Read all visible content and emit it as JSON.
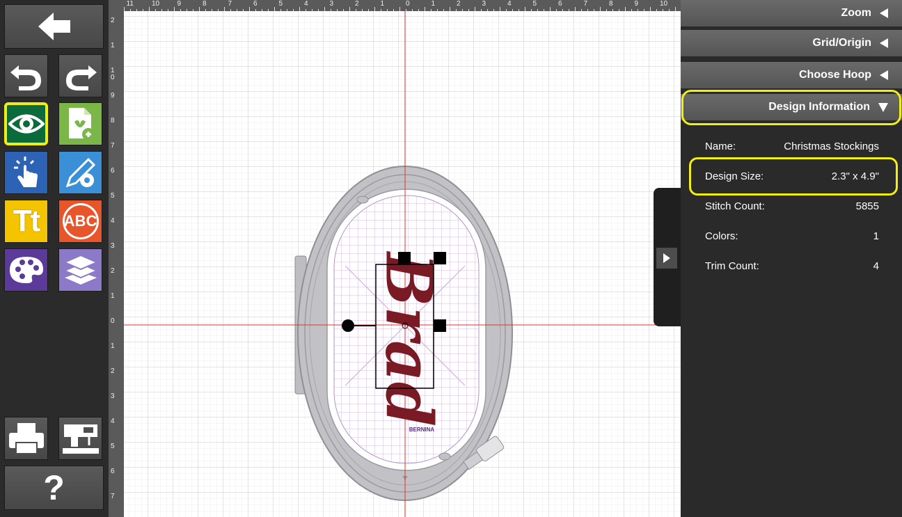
{
  "toolbar": {
    "back": "back-arrow-icon",
    "undo": "undo-icon",
    "redo": "redo-icon",
    "view": "eye-icon",
    "add_design": "new-design-icon",
    "select": "touch-select-icon",
    "edit": "edit-gear-icon",
    "text": "Tt",
    "monogram": "ABC",
    "colors": "palette-icon",
    "layers": "layers-icon",
    "print": "printer-icon",
    "send": "sewing-machine-icon",
    "help": "?"
  },
  "ruler": {
    "top": [
      "11",
      "10",
      "9",
      "8",
      "7",
      "6",
      "5",
      "4",
      "3",
      "2",
      "1",
      "0",
      "1",
      "2",
      "3",
      "4",
      "5",
      "6",
      "7",
      "8",
      "9",
      "10"
    ],
    "left": [
      "2",
      "1",
      "1\n0",
      "9",
      "8",
      "7",
      "6",
      "5",
      "4",
      "3",
      "2",
      "1",
      "0",
      "1",
      "2",
      "3",
      "4",
      "5",
      "6",
      "7"
    ]
  },
  "canvas": {
    "hoop_brand": "BERNINA",
    "design_text": "Brad",
    "design_color": "#7a1a24"
  },
  "panel": {
    "sections": [
      {
        "label": "Zoom",
        "state": "collapsed"
      },
      {
        "label": "Grid/Origin",
        "state": "collapsed"
      },
      {
        "label": "Choose Hoop",
        "state": "collapsed"
      },
      {
        "label": "Design Information",
        "state": "expanded"
      }
    ],
    "info": {
      "name_label": "Name:",
      "name_value": "Christmas Stockings",
      "size_label": "Design Size:",
      "size_value": "2.3\" x 4.9\"",
      "stitch_label": "Stitch Count:",
      "stitch_value": "5855",
      "colors_label": "Colors:",
      "colors_value": "1",
      "trim_label": "Trim Count:",
      "trim_value": "4"
    }
  },
  "colors": {
    "highlight": "#f3ee12",
    "active_green": "#0b6b3a",
    "axis_red": "#e03030"
  }
}
